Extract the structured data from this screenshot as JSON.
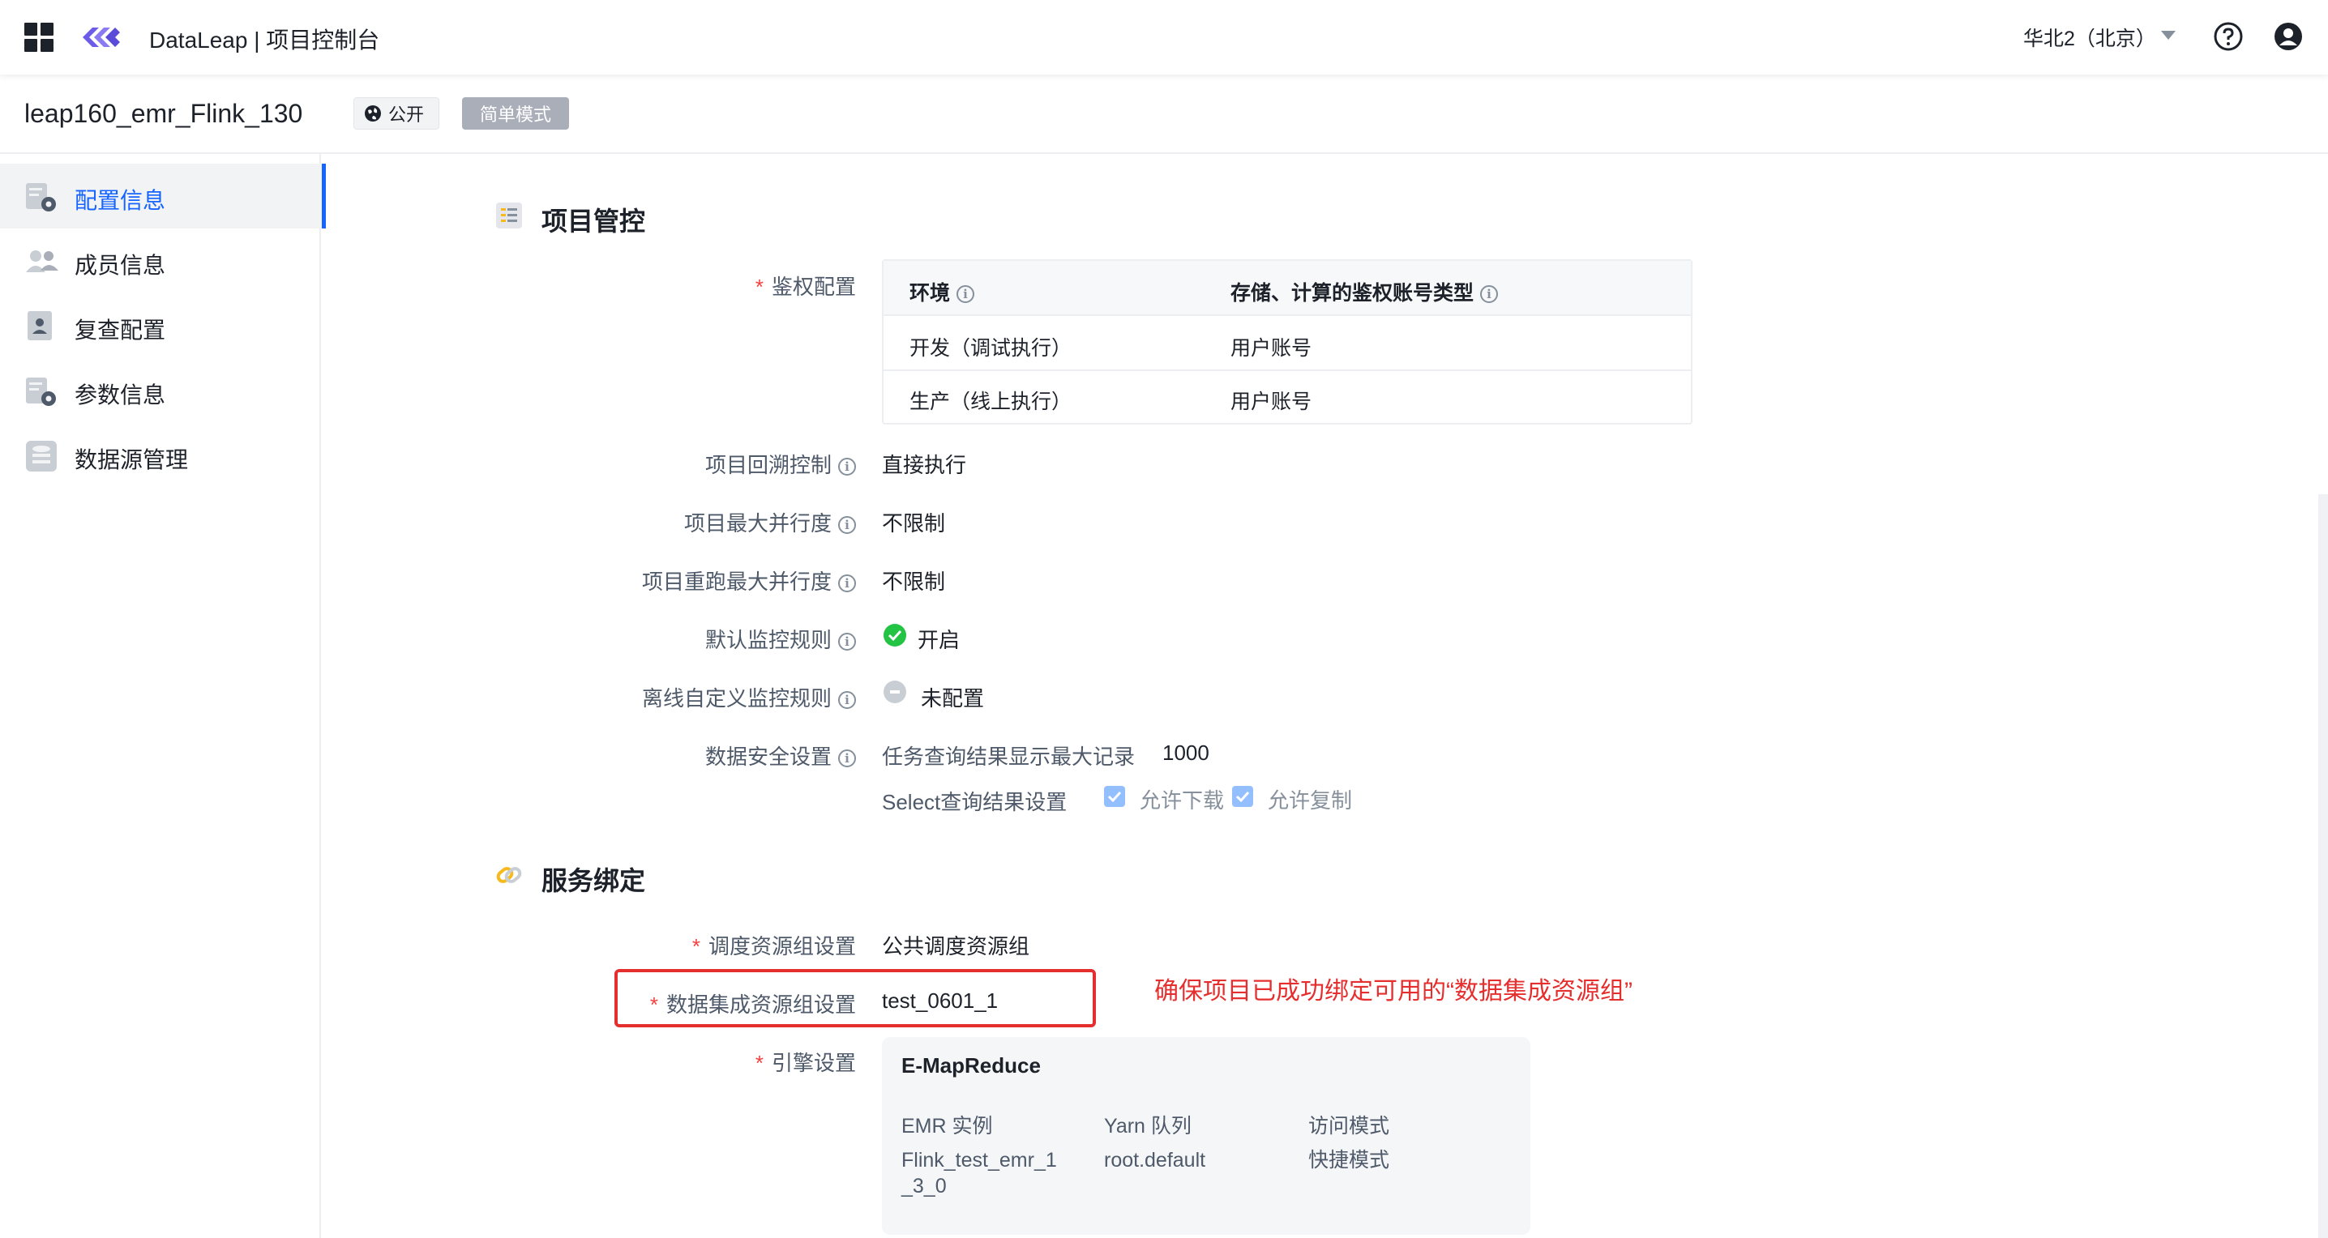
{
  "topbar": {
    "app_title": "DataLeap | 项目控制台",
    "region": "华北2（北京）"
  },
  "project": {
    "name": "leap160_emr_Flink_130",
    "tag_public": "公开",
    "tag_mode": "简单模式"
  },
  "sidebar": {
    "items": [
      {
        "label": "配置信息",
        "icon": "config-icon",
        "active": true
      },
      {
        "label": "成员信息",
        "icon": "members-icon",
        "active": false
      },
      {
        "label": "复查配置",
        "icon": "review-icon",
        "active": false
      },
      {
        "label": "参数信息",
        "icon": "params-icon",
        "active": false
      },
      {
        "label": "数据源管理",
        "icon": "datasource-icon",
        "active": false
      }
    ]
  },
  "project_control": {
    "title": "项目管控",
    "auth_label": "鉴权配置",
    "auth_table": {
      "headers": [
        "环境",
        "存储、计算的鉴权账号类型"
      ],
      "rows": [
        [
          "开发（调试执行）",
          "用户账号"
        ],
        [
          "生产（线上执行）",
          "用户账号"
        ]
      ]
    },
    "fields": [
      {
        "label": "项目回溯控制",
        "value": "直接执行"
      },
      {
        "label": "项目最大并行度",
        "value": "不限制"
      },
      {
        "label": "项目重跑最大并行度",
        "value": "不限制"
      },
      {
        "label": "默认监控规则",
        "value": "开启"
      },
      {
        "label": "离线自定义监控规则",
        "value": "未配置"
      }
    ],
    "security": {
      "label": "数据安全设置",
      "max_records_label": "任务查询结果显示最大记录",
      "max_records_value": "1000",
      "select_label": "Select查询结果设置",
      "allow_download": "允许下载",
      "allow_copy": "允许复制"
    }
  },
  "service_binding": {
    "title": "服务绑定",
    "schedule_label": "调度资源组设置",
    "schedule_value": "公共调度资源组",
    "integration_label": "数据集成资源组设置",
    "integration_value": "test_0601_1",
    "annotation": "确保项目已成功绑定可用的“数据集成资源组”",
    "engine_label": "引擎设置",
    "engine": {
      "name": "E-MapReduce",
      "headers": [
        "EMR 实例",
        "Yarn 队列",
        "访问模式"
      ],
      "instance": "Flink_test_emr_1_3_0",
      "instance_line1": "Flink_test_emr_1",
      "instance_line2": "_3_0",
      "queue": "root.default",
      "mode": "快捷模式"
    }
  },
  "colors": {
    "accent": "#1664ff",
    "required": "#f53f3f",
    "annotation": "#e52e2e",
    "success": "#23c343"
  }
}
